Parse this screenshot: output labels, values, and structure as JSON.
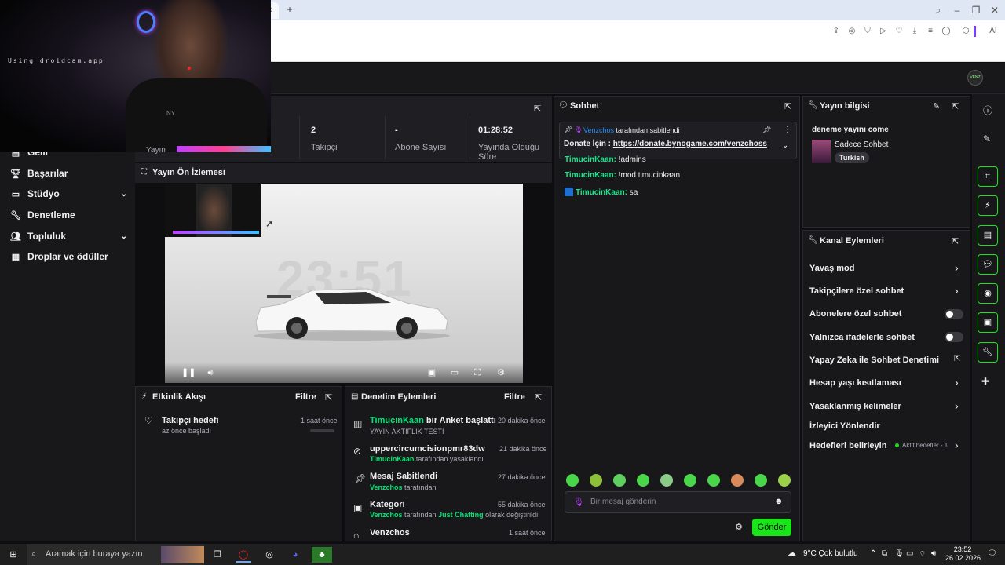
{
  "browser": {
    "tab_label": "d",
    "new_tab": "+",
    "window_buttons": [
      "search-icon",
      "minimize-icon",
      "restore-icon",
      "close-icon"
    ],
    "ai_label": "AI"
  },
  "camera": {
    "overlay_text": "Using droidcam.app",
    "shirt_text": "NY"
  },
  "sidebar": {
    "items": [
      {
        "label": "Gelir",
        "icon": "gelir-icon"
      },
      {
        "label": "Başarılar",
        "icon": "trophy-icon"
      },
      {
        "label": "Stüdyo",
        "icon": "studio-icon",
        "expandable": true
      },
      {
        "label": "Denetleme",
        "icon": "wrench-icon"
      },
      {
        "label": "Topluluk",
        "icon": "community-icon",
        "expandable": true
      },
      {
        "label": "Droplar ve ödüller",
        "icon": "drops-icon"
      }
    ]
  },
  "stats": {
    "items": [
      {
        "label": "Takipçi",
        "value": "2"
      },
      {
        "label": "Abone Sayısı",
        "value": "-"
      },
      {
        "label": "Yayında Olduğu Süre",
        "value": "01:28:52"
      }
    ],
    "partial_label": "Yayın"
  },
  "preview": {
    "title": "Yayın Ön İzlemesi",
    "clock": "23:51"
  },
  "activity": {
    "title": "Etkinlik Akışı",
    "filter": "Filtre",
    "items": [
      {
        "name": "Takipçi hedefi",
        "sub": "az önce başladı",
        "time": "1 saat önce"
      }
    ]
  },
  "moderation": {
    "title": "Denetim Eylemleri",
    "filter": "Filtre",
    "items": [
      {
        "title_user": "TimucinKaan",
        "title_rest": " bir Anket başlattı",
        "sub": "YAYIN AKTİFLİK TESTİ",
        "time": "20 dakika önce"
      },
      {
        "title": "uppercircumcisionpmr83dw",
        "sub_user": "TimucinKaan",
        "sub_rest": " tarafından yasaklandı",
        "time": "21 dakika önce"
      },
      {
        "title": "Mesaj Sabitlendi",
        "sub_user": "Venzchos",
        "sub_rest": " tarafından",
        "time": "27 dakika önce"
      },
      {
        "title": "Kategori",
        "sub_user": "Venzchos",
        "sub_mid": " tarafından ",
        "sub_cat": "Just Chatting",
        "sub_rest": " olarak değiştirildi",
        "time": "55 dakika önce"
      },
      {
        "title": "Venzchos",
        "time": "1 saat önce"
      }
    ]
  },
  "chat": {
    "title": "Sohbet",
    "pinned_by_user": "Venzchos",
    "pinned_by_rest": " tarafından sabitlendi",
    "pinned_prefix": "Donate İçin : ",
    "pinned_link": "https://donate.bynogame.com/venzchoss",
    "messages": [
      {
        "user": "TimucinKaan:",
        "text": " !admins"
      },
      {
        "user": "TimucinKaan:",
        "text": " !mod timucinkaan"
      },
      {
        "user": "TimucinKaan:",
        "text": " sa"
      }
    ],
    "input_placeholder": "Bir mesaj gönderin",
    "send_label": "Gönder"
  },
  "stream_info": {
    "title": "Yayın bilgisi",
    "stream_title": "deneme yayını come",
    "category": "Sadece Sohbet",
    "tag": "Turkish"
  },
  "channel_actions": {
    "title": "Kanal Eylemleri",
    "items": [
      {
        "label": "Yavaş mod",
        "control": "chevron"
      },
      {
        "label": "Takipçilere özel sohbet",
        "control": "chevron"
      },
      {
        "label": "Abonelere özel sohbet",
        "control": "toggle"
      },
      {
        "label": "Yalnızca ifadelerle sohbet",
        "control": "toggle"
      },
      {
        "label": "Yapay Zeka ile Sohbet Denetimi",
        "control": "external"
      },
      {
        "label": "Hesap yaşı kısıtlaması",
        "control": "chevron"
      },
      {
        "label": "Yasaklanmış kelimeler",
        "control": "chevron"
      },
      {
        "label": "İzleyici Yönlendir",
        "control": "none"
      },
      {
        "label": "Hedefleri belirleyin",
        "control": "chevron",
        "badge": "Aktif hedefler - 1"
      }
    ]
  },
  "taskbar": {
    "search_placeholder": "Aramak için buraya yazın",
    "weather": "9°C  Çok bulutlu",
    "time": "23:52",
    "date": "26.02.2026"
  },
  "colors": {
    "accent": "#19e619",
    "username": "#19e68c",
    "bg": "#0e0e10",
    "panel": "#18181b"
  }
}
